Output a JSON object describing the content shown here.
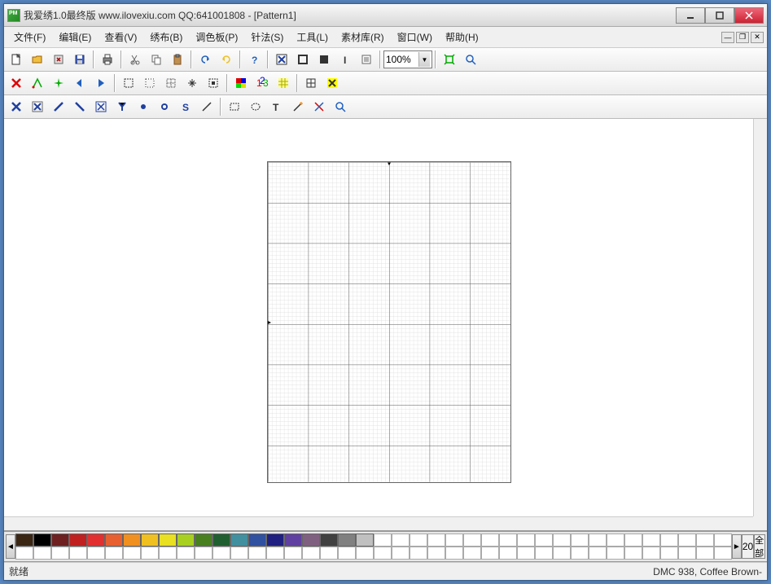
{
  "title": "我爱绣1.0最终版 www.ilovexiu.com QQ:641001808 - [Pattern1]",
  "menus": [
    "文件(F)",
    "编辑(E)",
    "查看(V)",
    "绣布(B)",
    "调色板(P)",
    "针法(S)",
    "工具(L)",
    "素材库(R)",
    "窗口(W)",
    "帮助(H)"
  ],
  "zoom": {
    "value": "100%"
  },
  "palette": {
    "colors": [
      "#3b2614",
      "#000000",
      "#6e2020",
      "#c02020",
      "#e23030",
      "#e86030",
      "#f09020",
      "#f0c020",
      "#e8e020",
      "#a8d020",
      "#488020",
      "#206030",
      "#4090a0",
      "#3050a0",
      "#202080",
      "#6040a0",
      "#806080",
      "#404040",
      "#808080",
      "#c0c0c0"
    ],
    "count": "20",
    "label": "全部"
  },
  "status": {
    "left": "就绪",
    "right": "DMC  938, Coffee Brown-"
  },
  "toolbar1_icons": [
    "new",
    "open",
    "close",
    "save",
    "print",
    "cut",
    "copy",
    "paste",
    "undo",
    "redo",
    "help",
    "cross",
    "box",
    "fill",
    "info",
    "list",
    "fit",
    "zoom"
  ],
  "toolbar2_icons": [
    "x-red",
    "arrow-g",
    "sparkle",
    "back",
    "play",
    "sel-dash",
    "sel-dot",
    "sel-grid",
    "star",
    "pattern",
    "palette",
    "123",
    "grid2",
    "grid",
    "x-yellow"
  ],
  "toolbar3_icons": [
    "x-blue",
    "x-out",
    "diag1",
    "diag2",
    "box-x",
    "y-down",
    "dot",
    "gear",
    "s",
    "line",
    "sel-rect",
    "circle",
    "text",
    "wand",
    "cut2",
    "magnify"
  ]
}
